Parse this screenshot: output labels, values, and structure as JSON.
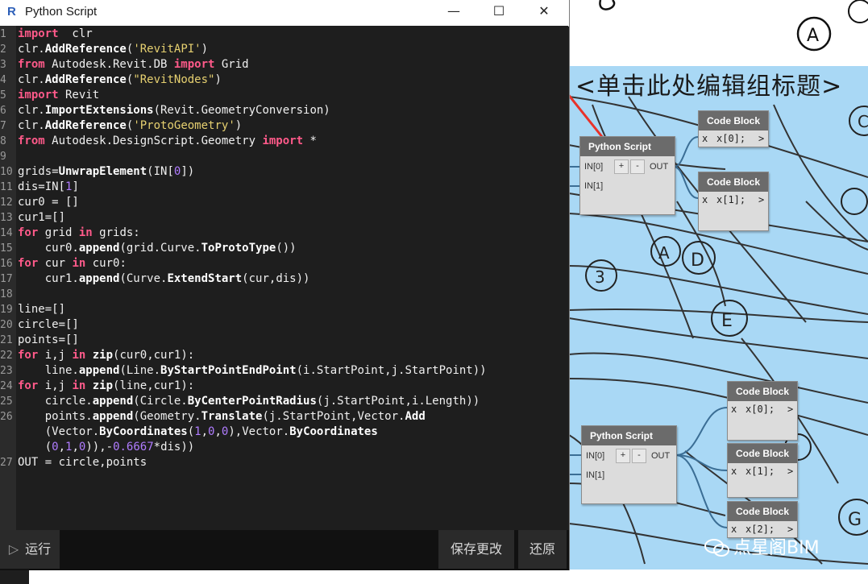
{
  "window": {
    "title": "Python Script",
    "minimize_glyph": "—",
    "maximize_glyph": "☐",
    "close_glyph": "✕",
    "app_icon": "R"
  },
  "editor": {
    "lines": [
      {
        "n": "1",
        "tokens": [
          [
            "kw",
            "import"
          ],
          [
            "",
            "  clr"
          ]
        ]
      },
      {
        "n": "2",
        "tokens": [
          [
            "",
            "clr."
          ],
          [
            "fn",
            "AddReference"
          ],
          [
            "",
            "("
          ],
          [
            "str",
            "'RevitAPI'"
          ],
          [
            "",
            ")"
          ]
        ]
      },
      {
        "n": "3",
        "tokens": [
          [
            "kw",
            "from"
          ],
          [
            "",
            " Autodesk.Revit.DB "
          ],
          [
            "kw",
            "import"
          ],
          [
            "",
            " Grid"
          ]
        ]
      },
      {
        "n": "4",
        "tokens": [
          [
            "",
            "clr."
          ],
          [
            "fn",
            "AddReference"
          ],
          [
            "",
            "("
          ],
          [
            "str",
            "\"RevitNodes\""
          ],
          [
            "",
            ")"
          ]
        ]
      },
      {
        "n": "5",
        "tokens": [
          [
            "kw",
            "import"
          ],
          [
            "",
            " Revit"
          ]
        ]
      },
      {
        "n": "6",
        "tokens": [
          [
            "",
            "clr."
          ],
          [
            "fn",
            "ImportExtensions"
          ],
          [
            "",
            "(Revit.GeometryConversion)"
          ]
        ]
      },
      {
        "n": "7",
        "tokens": [
          [
            "",
            "clr."
          ],
          [
            "fn",
            "AddReference"
          ],
          [
            "",
            "("
          ],
          [
            "str",
            "'ProtoGeometry'"
          ],
          [
            "",
            ")"
          ]
        ]
      },
      {
        "n": "8",
        "tokens": [
          [
            "kw",
            "from"
          ],
          [
            "",
            " Autodesk.DesignScript.Geometry "
          ],
          [
            "kw",
            "import"
          ],
          [
            "",
            " *"
          ]
        ]
      },
      {
        "n": "9",
        "tokens": []
      },
      {
        "n": "10",
        "tokens": [
          [
            "",
            "grids="
          ],
          [
            "fn",
            "UnwrapElement"
          ],
          [
            "",
            "(IN["
          ],
          [
            "num",
            "0"
          ],
          [
            "",
            "])"
          ]
        ]
      },
      {
        "n": "11",
        "tokens": [
          [
            "",
            "dis=IN["
          ],
          [
            "num",
            "1"
          ],
          [
            "",
            "]"
          ]
        ]
      },
      {
        "n": "12",
        "tokens": [
          [
            "",
            "cur0 = []"
          ]
        ]
      },
      {
        "n": "13",
        "tokens": [
          [
            "",
            "cur1=[]"
          ]
        ]
      },
      {
        "n": "14",
        "tokens": [
          [
            "kw",
            "for"
          ],
          [
            "",
            " grid "
          ],
          [
            "kw",
            "in"
          ],
          [
            "",
            " grids:"
          ]
        ]
      },
      {
        "n": "15",
        "tokens": [
          [
            "",
            "    cur0."
          ],
          [
            "fn",
            "append"
          ],
          [
            "",
            "(grid.Curve."
          ],
          [
            "fn",
            "ToProtoType"
          ],
          [
            "",
            "())"
          ]
        ]
      },
      {
        "n": "16",
        "tokens": [
          [
            "kw",
            "for"
          ],
          [
            "",
            " cur "
          ],
          [
            "kw",
            "in"
          ],
          [
            "",
            " cur0:"
          ]
        ]
      },
      {
        "n": "17",
        "tokens": [
          [
            "",
            "    cur1."
          ],
          [
            "fn",
            "append"
          ],
          [
            "",
            "(Curve."
          ],
          [
            "fn",
            "ExtendStart"
          ],
          [
            "",
            "(cur,dis))"
          ]
        ]
      },
      {
        "n": "18",
        "tokens": []
      },
      {
        "n": "19",
        "tokens": [
          [
            "",
            "line=[]"
          ]
        ]
      },
      {
        "n": "20",
        "tokens": [
          [
            "",
            "circle=[]"
          ]
        ]
      },
      {
        "n": "21",
        "tokens": [
          [
            "",
            "points=[]"
          ]
        ]
      },
      {
        "n": "22",
        "tokens": [
          [
            "kw",
            "for"
          ],
          [
            "",
            " i,j "
          ],
          [
            "kw",
            "in"
          ],
          [
            "",
            " "
          ],
          [
            "fn",
            "zip"
          ],
          [
            "",
            "(cur0,cur1):"
          ]
        ]
      },
      {
        "n": "23",
        "tokens": [
          [
            "",
            "    line."
          ],
          [
            "fn",
            "append"
          ],
          [
            "",
            "(Line."
          ],
          [
            "fn",
            "ByStartPointEndPoint"
          ],
          [
            "",
            "(i.StartPoint,j.StartPoint))"
          ]
        ]
      },
      {
        "n": "24",
        "tokens": [
          [
            "kw",
            "for"
          ],
          [
            "",
            " i,j "
          ],
          [
            "kw",
            "in"
          ],
          [
            "",
            " "
          ],
          [
            "fn",
            "zip"
          ],
          [
            "",
            "(line,cur1):"
          ]
        ]
      },
      {
        "n": "25",
        "tokens": [
          [
            "",
            "    circle."
          ],
          [
            "fn",
            "append"
          ],
          [
            "",
            "(Circle."
          ],
          [
            "fn",
            "ByCenterPointRadius"
          ],
          [
            "",
            "(j.StartPoint,i.Length))"
          ]
        ]
      },
      {
        "n": "26",
        "tokens": [
          [
            "",
            "    points."
          ],
          [
            "fn",
            "append"
          ],
          [
            "",
            "(Geometry."
          ],
          [
            "fn",
            "Translate"
          ],
          [
            "",
            "(j.StartPoint,Vector."
          ],
          [
            "fn",
            "Add"
          ]
        ]
      },
      {
        "n": "",
        "tokens": [
          [
            "",
            "    (Vector."
          ],
          [
            "fn",
            "ByCoordinates"
          ],
          [
            "",
            "("
          ],
          [
            "num",
            "1"
          ],
          [
            "",
            ","
          ],
          [
            "num",
            "0"
          ],
          [
            "",
            ","
          ],
          [
            "num",
            "0"
          ],
          [
            "",
            "),Vector."
          ],
          [
            "fn",
            "ByCoordinates"
          ]
        ]
      },
      {
        "n": "",
        "tokens": [
          [
            "",
            "    ("
          ],
          [
            "num",
            "0"
          ],
          [
            "",
            ","
          ],
          [
            "num",
            "1"
          ],
          [
            "",
            ","
          ],
          [
            "num",
            "0"
          ],
          [
            "",
            "))"
          ],
          [
            "",
            ",-"
          ],
          [
            "num",
            "0.6667"
          ],
          [
            "",
            "*dis))"
          ]
        ]
      },
      {
        "n": "27",
        "tokens": [
          [
            "",
            "OUT = circle,points"
          ]
        ]
      }
    ]
  },
  "bottom": {
    "run_label": "运行",
    "run_icon": "▷",
    "save_label": "保存更改",
    "revert_label": "还原"
  },
  "canvas": {
    "group_title": "<单击此处编辑组标题>",
    "group_color": "#a9d8f5",
    "grid_labels": [
      "A",
      "A",
      "D",
      "E",
      "3",
      "G",
      "C"
    ],
    "python_nodes": [
      {
        "title": "Python Script",
        "in0": "IN[0]",
        "in1": "IN[1]",
        "plus": "+",
        "minus": "-",
        "out": "OUT"
      },
      {
        "title": "Python Script",
        "in0": "IN[0]",
        "in1": "IN[1]",
        "plus": "+",
        "minus": "-",
        "out": "OUT"
      }
    ],
    "code_blocks": [
      {
        "title": "Code Block",
        "x": "x",
        "code": "x[0];",
        "out": ">"
      },
      {
        "title": "Code Block",
        "x": "x",
        "code": "x[1];",
        "out": ">"
      },
      {
        "title": "Code Block",
        "x": "x",
        "code": "x[0];",
        "out": ">"
      },
      {
        "title": "Code Block",
        "x": "x",
        "code": "x[1];",
        "out": ">"
      },
      {
        "title": "Code Block",
        "x": "x",
        "code": "x[2];",
        "out": ">"
      }
    ]
  },
  "watermark": "点星阁BIM"
}
